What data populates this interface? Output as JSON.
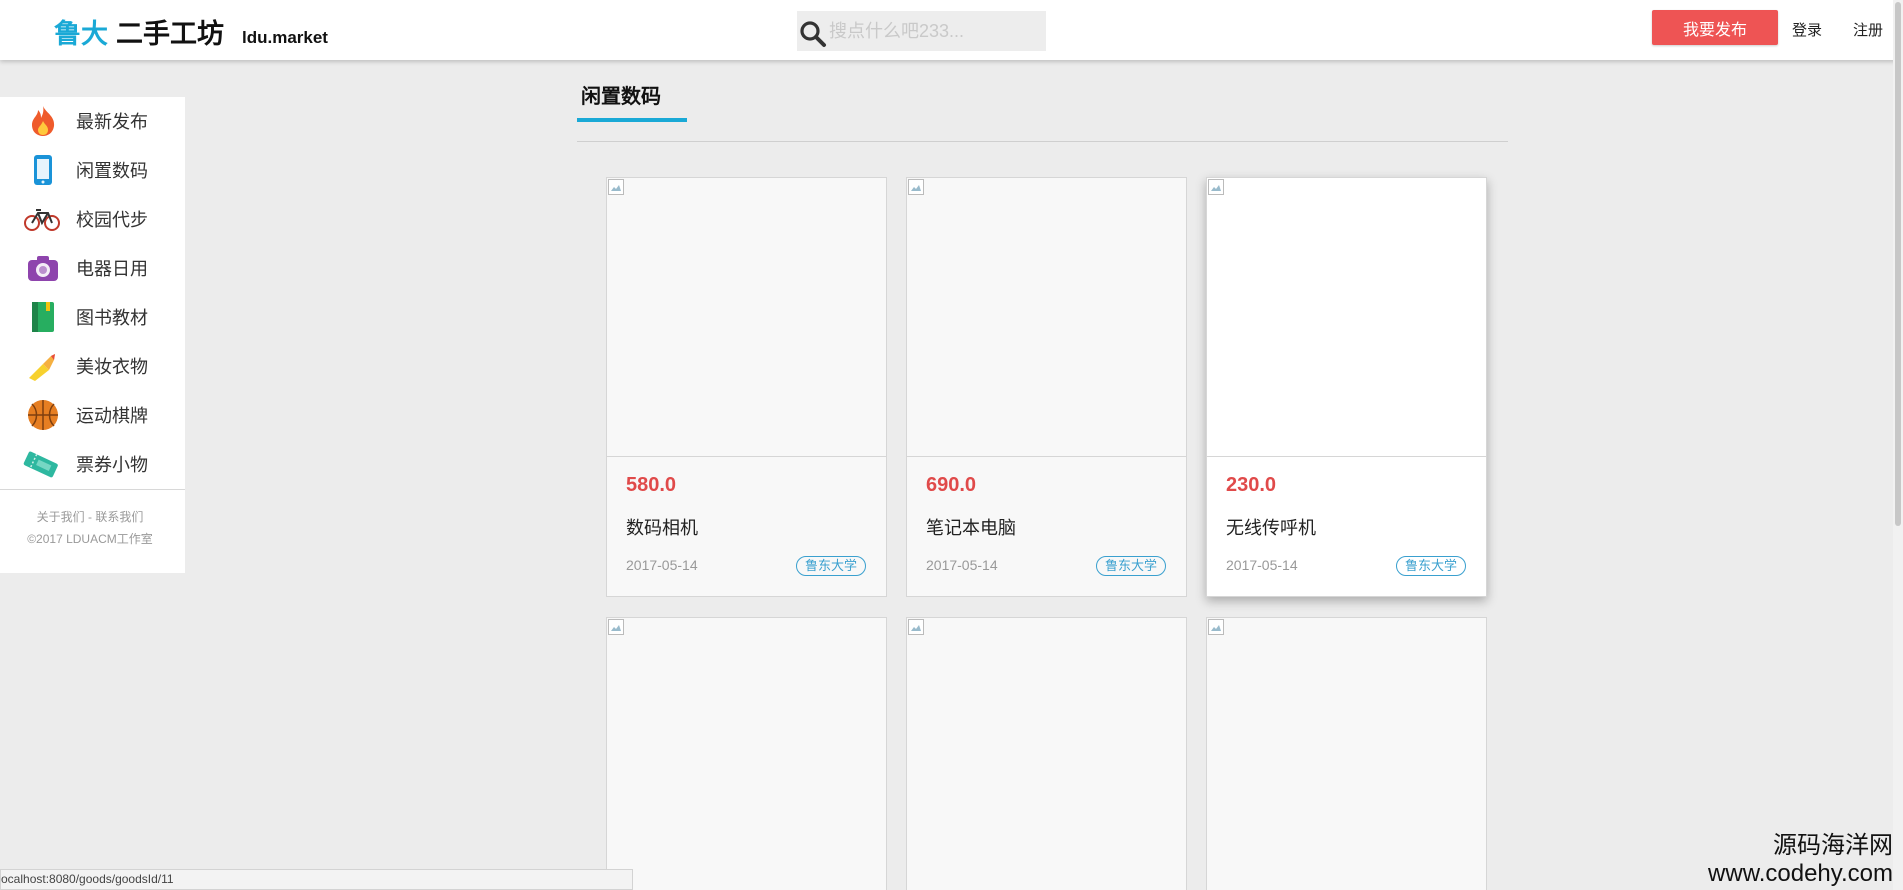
{
  "header": {
    "logo_part1": "鲁大",
    "logo_part2": "二手工坊",
    "logo_domain": "ldu.market",
    "search_placeholder": "搜点什么吧233...",
    "publish_label": "我要发布",
    "login_label": "登录",
    "register_label": "注册",
    "accent_color": "#1aa9d6",
    "publish_color": "#ee5454"
  },
  "sidebar": {
    "items": [
      {
        "label": "最新发布",
        "icon": "fire-icon"
      },
      {
        "label": "闲置数码",
        "icon": "phone-icon"
      },
      {
        "label": "校园代步",
        "icon": "bicycle-icon"
      },
      {
        "label": "电器日用",
        "icon": "camera-icon"
      },
      {
        "label": "图书教材",
        "icon": "book-icon"
      },
      {
        "label": "美妆衣物",
        "icon": "lipstick-icon"
      },
      {
        "label": "运动棋牌",
        "icon": "basketball-icon"
      },
      {
        "label": "票券小物",
        "icon": "ticket-icon"
      }
    ],
    "footer_links": "关于我们 - 联系我们",
    "footer_copyright": "©2017 LDUACM工作室"
  },
  "main": {
    "section_title": "闲置数码",
    "cards": [
      {
        "price": "580.0",
        "name": "数码相机",
        "date": "2017-05-14",
        "tag": "鲁东大学"
      },
      {
        "price": "690.0",
        "name": "笔记本电脑",
        "date": "2017-05-14",
        "tag": "鲁东大学"
      },
      {
        "price": "230.0",
        "name": "无线传呼机",
        "date": "2017-05-14",
        "tag": "鲁东大学"
      }
    ]
  },
  "statusbar": {
    "url": "ocalhost:8080/goods/goodsId/11"
  },
  "watermark": {
    "cn": "源码海洋网",
    "en": "www.codehy.com"
  }
}
